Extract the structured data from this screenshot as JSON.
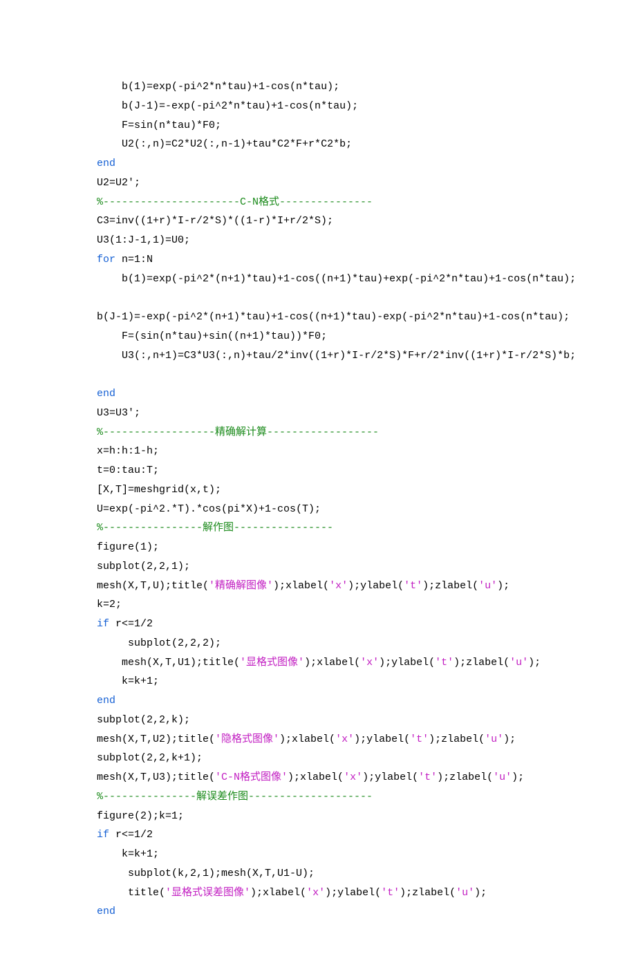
{
  "lines": [
    {
      "indent": 1,
      "segs": [
        {
          "t": "b(1)=exp(-pi^2*n*tau)+1-cos(n*tau);"
        }
      ]
    },
    {
      "indent": 1,
      "segs": [
        {
          "t": "b(J-1)=-exp(-pi^2*n*tau)+1-cos(n*tau);"
        }
      ]
    },
    {
      "indent": 1,
      "segs": [
        {
          "t": "F=sin(n*tau)*F0;"
        }
      ]
    },
    {
      "indent": 1,
      "segs": [
        {
          "t": "U2(:,n)=C2*U2(:,n-1)+tau*C2*F+r*C2*b;"
        }
      ]
    },
    {
      "indent": 0,
      "segs": [
        {
          "c": "kw",
          "t": "end"
        }
      ]
    },
    {
      "indent": 0,
      "segs": [
        {
          "t": "U2=U2';"
        }
      ]
    },
    {
      "indent": 0,
      "segs": [
        {
          "c": "cm",
          "t": "%----------------------C-N格式---------------"
        }
      ]
    },
    {
      "indent": 0,
      "segs": [
        {
          "t": "C3=inv((1+r)*I-r/2*S)*((1-r)*I+r/2*S);"
        }
      ]
    },
    {
      "indent": 0,
      "segs": [
        {
          "t": "U3(1:J-1,1)=U0;"
        }
      ]
    },
    {
      "indent": 0,
      "segs": [
        {
          "c": "kw",
          "t": "for"
        },
        {
          "t": " n=1:N"
        }
      ]
    },
    {
      "indent": 1,
      "segs": [
        {
          "t": "b(1)=exp(-pi^2*(n+1)*tau)+1-cos((n+1)*tau)+exp(-pi^2*n*tau)+1-cos(n*tau);"
        }
      ]
    },
    {
      "indent": 0,
      "segs": [
        {
          "t": " "
        }
      ]
    },
    {
      "indent": 0,
      "segs": [
        {
          "t": "b(J-1)=-exp(-pi^2*(n+1)*tau)+1-cos((n+1)*tau)-exp(-pi^2*n*tau)+1-cos(n*tau);"
        }
      ]
    },
    {
      "indent": 1,
      "segs": [
        {
          "t": "F=(sin(n*tau)+sin((n+1)*tau))*F0;"
        }
      ]
    },
    {
      "indent": 1,
      "segs": [
        {
          "t": "U3(:,n+1)=C3*U3(:,n)+tau/2*inv((1+r)*I-r/2*S)*F+r/2*inv((1+r)*I-r/2*S)*b;"
        }
      ]
    },
    {
      "indent": 0,
      "segs": [
        {
          "t": " "
        }
      ]
    },
    {
      "indent": 0,
      "segs": [
        {
          "c": "kw",
          "t": "end"
        }
      ]
    },
    {
      "indent": 0,
      "segs": [
        {
          "t": "U3=U3';"
        }
      ]
    },
    {
      "indent": 0,
      "segs": [
        {
          "c": "cm",
          "t": "%------------------精确解计算------------------"
        }
      ]
    },
    {
      "indent": 0,
      "segs": [
        {
          "t": "x=h:h:1-h;"
        }
      ]
    },
    {
      "indent": 0,
      "segs": [
        {
          "t": "t=0:tau:T;"
        }
      ]
    },
    {
      "indent": 0,
      "segs": [
        {
          "t": "[X,T]=meshgrid(x,t);"
        }
      ]
    },
    {
      "indent": 0,
      "segs": [
        {
          "t": "U=exp(-pi^2.*T).*cos(pi*X)+1-cos(T);"
        }
      ]
    },
    {
      "indent": 0,
      "segs": [
        {
          "c": "cm",
          "t": "%----------------解作图----------------"
        }
      ]
    },
    {
      "indent": 0,
      "segs": [
        {
          "t": "figure(1);"
        }
      ]
    },
    {
      "indent": 0,
      "segs": [
        {
          "t": "subplot(2,2,1);"
        }
      ]
    },
    {
      "indent": 0,
      "segs": [
        {
          "t": "mesh(X,T,U);title("
        },
        {
          "c": "str",
          "t": "'精确解图像'"
        },
        {
          "t": ");xlabel("
        },
        {
          "c": "str",
          "t": "'x'"
        },
        {
          "t": ");ylabel("
        },
        {
          "c": "str",
          "t": "'t'"
        },
        {
          "t": ");zlabel("
        },
        {
          "c": "str",
          "t": "'u'"
        },
        {
          "t": ");"
        }
      ]
    },
    {
      "indent": 0,
      "segs": [
        {
          "t": "k=2;"
        }
      ]
    },
    {
      "indent": 0,
      "segs": [
        {
          "c": "kw",
          "t": "if"
        },
        {
          "t": " r<=1/2"
        }
      ]
    },
    {
      "indent": 1,
      "segs": [
        {
          "t": " subplot(2,2,2);"
        }
      ]
    },
    {
      "indent": 1,
      "segs": [
        {
          "t": "mesh(X,T,U1);title("
        },
        {
          "c": "str",
          "t": "'显格式图像'"
        },
        {
          "t": ");xlabel("
        },
        {
          "c": "str",
          "t": "'x'"
        },
        {
          "t": ");ylabel("
        },
        {
          "c": "str",
          "t": "'t'"
        },
        {
          "t": ");zlabel("
        },
        {
          "c": "str",
          "t": "'u'"
        },
        {
          "t": ");"
        }
      ]
    },
    {
      "indent": 1,
      "segs": [
        {
          "t": "k=k+1;"
        }
      ]
    },
    {
      "indent": 0,
      "segs": [
        {
          "c": "kw",
          "t": "end"
        }
      ]
    },
    {
      "indent": 0,
      "segs": [
        {
          "t": "subplot(2,2,k);"
        }
      ]
    },
    {
      "indent": 0,
      "segs": [
        {
          "t": "mesh(X,T,U2);title("
        },
        {
          "c": "str",
          "t": "'隐格式图像'"
        },
        {
          "t": ");xlabel("
        },
        {
          "c": "str",
          "t": "'x'"
        },
        {
          "t": ");ylabel("
        },
        {
          "c": "str",
          "t": "'t'"
        },
        {
          "t": ");zlabel("
        },
        {
          "c": "str",
          "t": "'u'"
        },
        {
          "t": ");"
        }
      ]
    },
    {
      "indent": 0,
      "segs": [
        {
          "t": "subplot(2,2,k+1);"
        }
      ]
    },
    {
      "indent": 0,
      "segs": [
        {
          "t": "mesh(X,T,U3);title("
        },
        {
          "c": "str",
          "t": "'C-N格式图像'"
        },
        {
          "t": ");xlabel("
        },
        {
          "c": "str",
          "t": "'x'"
        },
        {
          "t": ");ylabel("
        },
        {
          "c": "str",
          "t": "'t'"
        },
        {
          "t": ");zlabel("
        },
        {
          "c": "str",
          "t": "'u'"
        },
        {
          "t": ");"
        }
      ]
    },
    {
      "indent": 0,
      "segs": [
        {
          "c": "cm",
          "t": "%---------------解误差作图--------------------"
        }
      ]
    },
    {
      "indent": 0,
      "segs": [
        {
          "t": "figure(2);k=1;"
        }
      ]
    },
    {
      "indent": 0,
      "segs": [
        {
          "c": "kw",
          "t": "if"
        },
        {
          "t": " r<=1/2"
        }
      ]
    },
    {
      "indent": 1,
      "segs": [
        {
          "t": "k=k+1;"
        }
      ]
    },
    {
      "indent": 1,
      "segs": [
        {
          "t": " subplot(k,2,1);mesh(X,T,U1-U);"
        }
      ]
    },
    {
      "indent": 1,
      "segs": [
        {
          "t": " title("
        },
        {
          "c": "str",
          "t": "'显格式误差图像'"
        },
        {
          "t": ");xlabel("
        },
        {
          "c": "str",
          "t": "'x'"
        },
        {
          "t": ");ylabel("
        },
        {
          "c": "str",
          "t": "'t'"
        },
        {
          "t": ");zlabel("
        },
        {
          "c": "str",
          "t": "'u'"
        },
        {
          "t": ");"
        }
      ]
    },
    {
      "indent": 0,
      "segs": [
        {
          "c": "kw",
          "t": "end"
        }
      ]
    }
  ]
}
